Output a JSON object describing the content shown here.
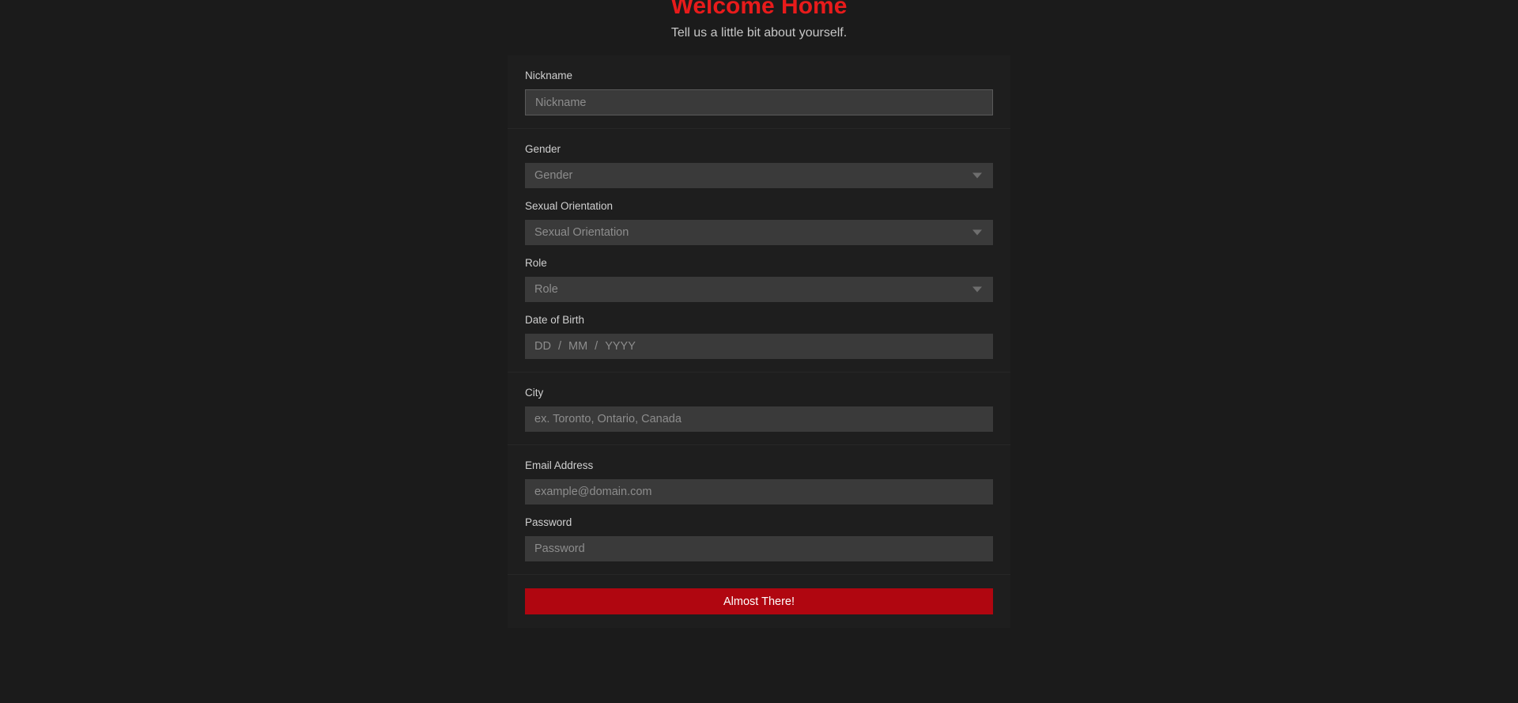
{
  "header": {
    "title": "Welcome Home",
    "subtitle": "Tell us a little bit about yourself.",
    "title_color": "#e81b1b"
  },
  "form": {
    "nickname": {
      "label": "Nickname",
      "placeholder": "Nickname",
      "value": ""
    },
    "gender": {
      "label": "Gender",
      "placeholder": "Gender",
      "value": "",
      "icon": "chevron-down-icon"
    },
    "sexual_orientation": {
      "label": "Sexual Orientation",
      "placeholder": "Sexual Orientation",
      "value": "",
      "icon": "chevron-down-icon"
    },
    "role": {
      "label": "Role",
      "placeholder": "Role",
      "value": "",
      "icon": "chevron-down-icon"
    },
    "date_of_birth": {
      "label": "Date of Birth",
      "day_placeholder": "DD",
      "month_placeholder": "MM",
      "year_placeholder": "YYYY",
      "separator": "/"
    },
    "city": {
      "label": "City",
      "placeholder": "ex. Toronto, Ontario, Canada",
      "value": ""
    },
    "email": {
      "label": "Email Address",
      "placeholder": "example@domain.com",
      "value": ""
    },
    "password": {
      "label": "Password",
      "placeholder": "Password",
      "value": ""
    }
  },
  "submit": {
    "label": "Almost There!",
    "color": "#b00610"
  }
}
